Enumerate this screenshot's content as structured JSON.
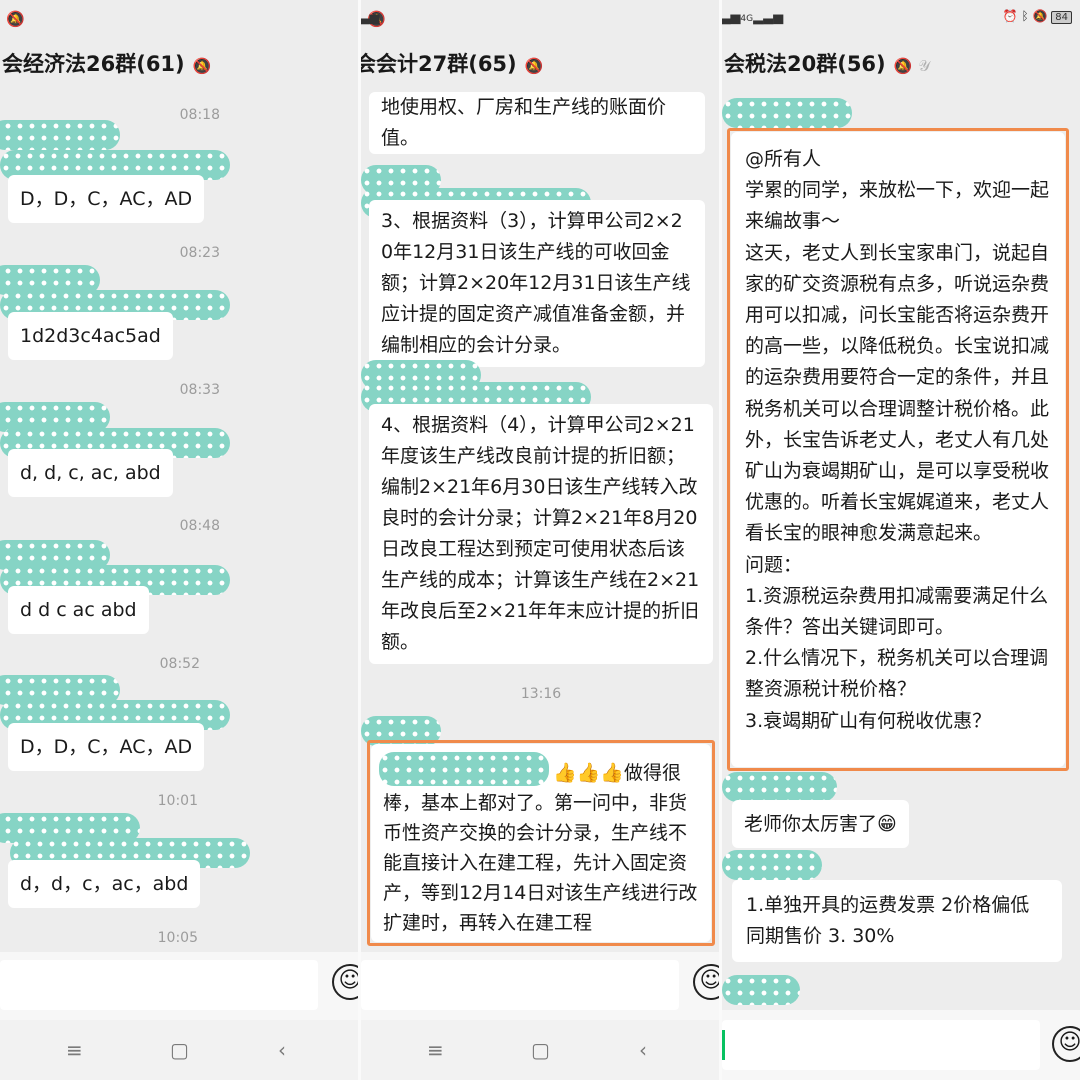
{
  "status_bar": {
    "left_icon": "mute-bell-icon",
    "hd": "HD",
    "network": "4G",
    "network2": "4G",
    "battery": "84"
  },
  "panels": [
    {
      "title": "会经济法26群(61)",
      "messages": [
        {
          "time": "08:18",
          "text": "D，D，C，AC，AD"
        },
        {
          "time": "08:23",
          "text": "1d2d3c4ac5ad"
        },
        {
          "time": "08:33",
          "text": "d, d, c, ac, abd"
        },
        {
          "time": "08:48",
          "text": "d d  c  ac abd"
        },
        {
          "time": "08:52",
          "text": "D，D，C，AC，AD"
        },
        {
          "time": "10:01",
          "text": "d，d，c，ac，abd"
        },
        {
          "time": "10:05",
          "text": ""
        }
      ]
    },
    {
      "title": "会会计27群(65)",
      "messages": [
        {
          "text": "地使用权、厂房和生产线的账面价值。"
        },
        {
          "text": "3、根据资料（3），计算甲公司2×20年12月31日该生产线的可收回金额；计算2×20年12月31日该生产线应计提的固定资产减值准备金额，并编制相应的会计分录。"
        },
        {
          "text": "4、根据资料（4），计算甲公司2×21年度该生产线改良前计提的折旧额；编制2×21年6月30日该生产线转入改良时的会计分录；计算2×21年8月20日改良工程达到预定可使用状态后该生产线的成本；计算该生产线在2×21年改良后至2×21年年末应计提的折旧额。"
        },
        {
          "time": "13:16",
          "text": "👍👍👍做得很棒，基本上都对了。第一问中，非货币性资产交换的会计分录，生产线不能直接计入在建工程，先计入固定资产，等到12月14日对该生产线进行改扩建时，再转入在建工程"
        }
      ]
    },
    {
      "title": "会税法20群(56)",
      "messages": [
        {
          "text": "@所有人\n学累的同学，来放松一下，欢迎一起来编故事～\n这天，老丈人到长宝家串门，说起自家的矿交资源税有点多，听说运杂费用可以扣减，问长宝能否将运杂费开的高一些，以降低税负。长宝说扣减的运杂费用要符合一定的条件，并且税务机关可以合理调整计税价格。此外，长宝告诉老丈人，老丈人有几处矿山为衰竭期矿山，是可以享受税收优惠的。听着长宝娓娓道来，老丈人看长宝的眼神愈发满意起来。\n问题：\n1.资源税运杂费用扣减需要满足什么条件？答出关键词即可。\n2.什么情况下，税务机关可以合理调整资源税计税价格？\n3.衰竭期矿山有何税收优惠？"
        },
        {
          "text": "老师你太厉害了😁"
        },
        {
          "text": "1.单独开具的运费发票  2价格偏低同期售价   3.  30%"
        }
      ]
    }
  ],
  "accent": {
    "highlight": "#f08a4b",
    "mask": "#86d4c5",
    "online": "#07c160"
  }
}
